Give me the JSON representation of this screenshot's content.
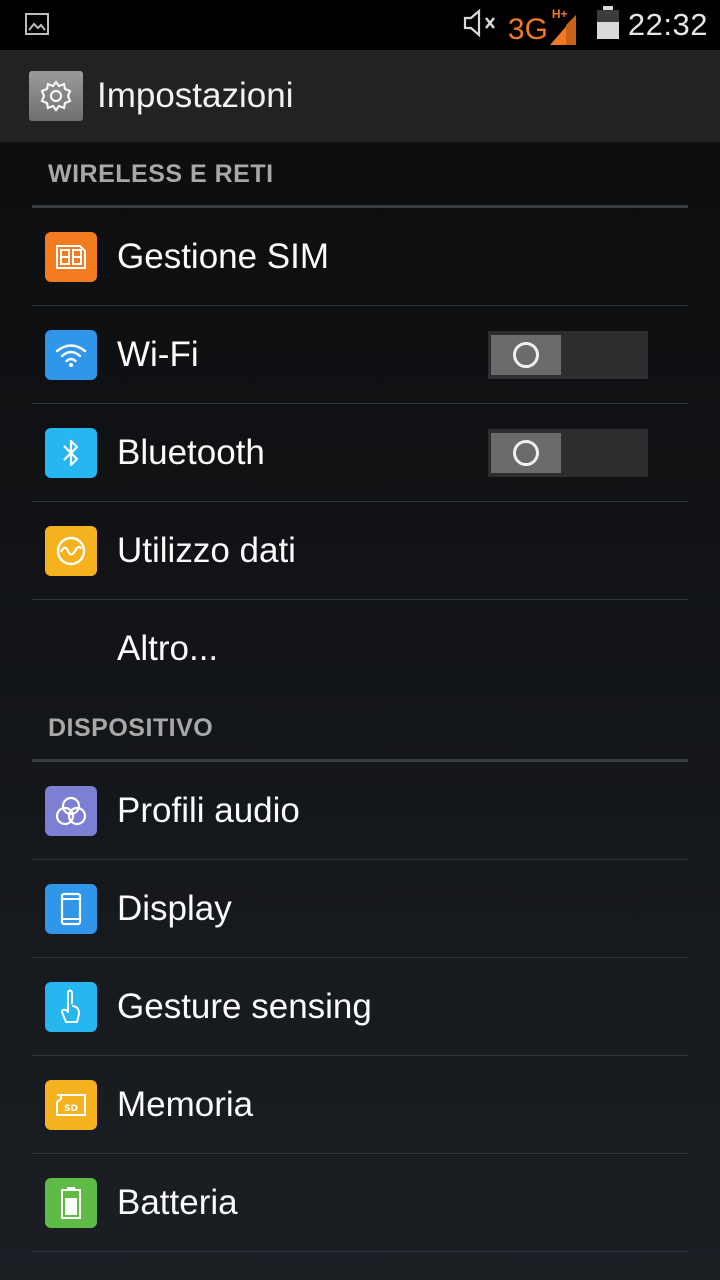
{
  "status_bar": {
    "notification_icon": "image-icon",
    "mute_icon": "volume-mute-icon",
    "network_type": "3G",
    "network_sub": "H+",
    "signal_icon": "signal-icon",
    "battery_icon": "battery-icon",
    "time": "22:32"
  },
  "action_bar": {
    "icon": "gear-icon",
    "title": "Impostazioni"
  },
  "sections": [
    {
      "header": "WIRELESS E RETI",
      "items": [
        {
          "label": "Gestione SIM",
          "icon": "sim-card-icon",
          "color": "#f47c20"
        },
        {
          "label": "Wi-Fi",
          "icon": "wifi-icon",
          "color": "#2f96ea",
          "toggle": "off"
        },
        {
          "label": "Bluetooth",
          "icon": "bluetooth-icon",
          "color": "#26b7f0",
          "toggle": "off"
        },
        {
          "label": "Utilizzo dati",
          "icon": "data-usage-icon",
          "color": "#f5b21e"
        },
        {
          "label": "Altro..."
        }
      ]
    },
    {
      "header": "DISPOSITIVO",
      "items": [
        {
          "label": "Profili audio",
          "icon": "audio-profiles-icon",
          "color": "#7d7fd2"
        },
        {
          "label": "Display",
          "icon": "display-icon",
          "color": "#2f96ea"
        },
        {
          "label": "Gesture sensing",
          "icon": "gesture-icon",
          "color": "#26b7f0"
        },
        {
          "label": "Memoria",
          "icon": "sd-card-icon",
          "color": "#f5b21e"
        },
        {
          "label": "Batteria",
          "icon": "battery-setting-icon",
          "color": "#5dbb46"
        }
      ]
    }
  ]
}
